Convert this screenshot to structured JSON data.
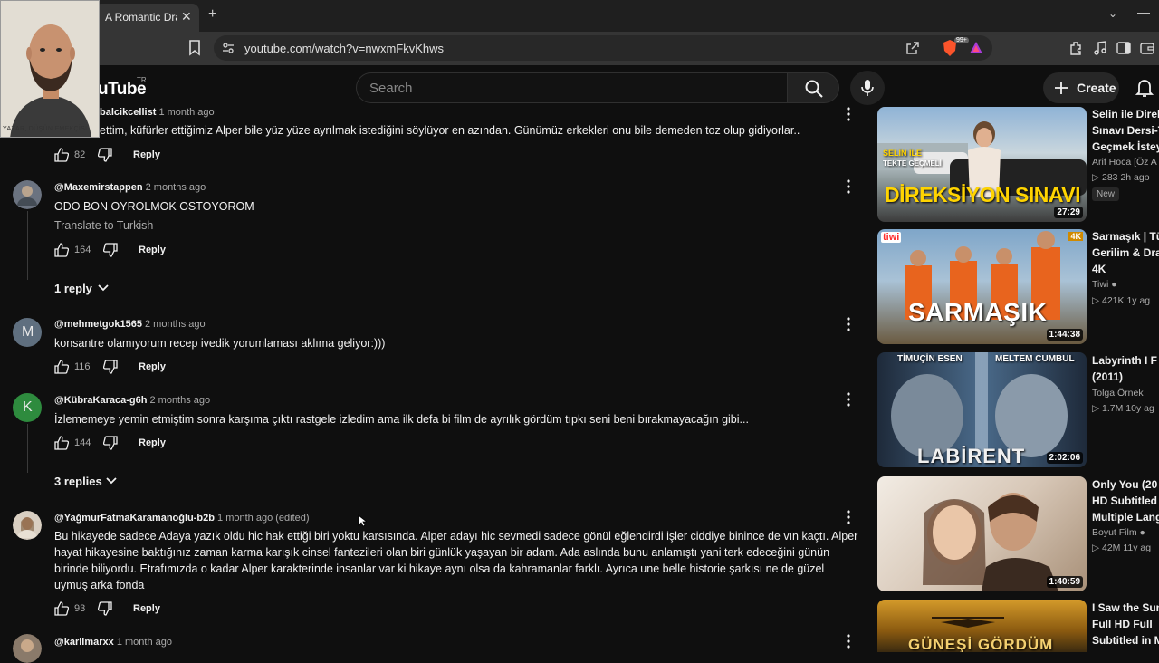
{
  "browser": {
    "tab_title": "A Romantic Dram",
    "url": "youtube.com/watch?v=nwxmFkvKhws",
    "brave_badge": "99+"
  },
  "webcam": {
    "caption": "YAZAR, DÜŞÜN EMEKÇİSİ"
  },
  "header": {
    "logo": "uTube",
    "region": "TR",
    "search_placeholder": "Search",
    "create_label": "Create"
  },
  "comments": [
    {
      "author": "balcikcellist",
      "time": "1 month ago",
      "text": "ettim, küfürler ettiğimiz Alper bile yüz yüze ayrılmak istediğini söylüyor en azından. Günümüz erkekleri onu bile demeden toz olup gidiyorlar..",
      "likes": "82",
      "reply_label": "Reply"
    },
    {
      "author": "@Maxemirstappen",
      "time": "2 months ago",
      "text": "ODO BON OYROLMOK OSTOYOROM",
      "translate": "Translate to Turkish",
      "likes": "164",
      "reply_label": "Reply",
      "replies": "1 reply"
    },
    {
      "author": "@mehmetgok1565",
      "time": "2 months ago",
      "avatar_letter": "M",
      "text": "konsantre olamıyorum recep ivedik yorumlaması aklıma geliyor:)))",
      "likes": "116",
      "reply_label": "Reply"
    },
    {
      "author": "@KübraKaraca-g6h",
      "time": "2 months ago",
      "avatar_letter": "K",
      "text": "İzlememeye yemin etmiştim sonra karşıma çıktı rastgele izledim ama ilk defa bi film de ayrılık gördüm tıpkı seni beni bırakmayacağın gibi...",
      "likes": "144",
      "reply_label": "Reply",
      "replies": "3 replies"
    },
    {
      "author": "@YağmurFatmaKaramanoğlu-b2b",
      "time": "1 month ago (edited)",
      "text": "Bu hikayede sadece Adaya yazık oldu hic hak ettiği biri yoktu karsısında. Alper adayı hic sevmedi sadece gönül eğlendirdi işler ciddiye binince de vın kaçtı. Alper hayat hikayesine baktığınız zaman karma karışık cinsel fantezileri olan biri günlük yaşayan bir adam. Ada aslında bunu anlamıştı yani terk edeceğini günün birinde biliyordu. Etrafımızda o kadar Alper karakterinde insanlar var ki hikaye aynı olsa da kahramanlar farklı. Ayrıca une belle historie şarkısı ne de güzel uymuş arka fonda",
      "likes": "93",
      "reply_label": "Reply"
    },
    {
      "author": "@karllmarxx",
      "time": "1 month ago"
    }
  ],
  "sidebar": [
    {
      "title_lines": [
        "Selin ile Direk",
        "Sınavı Dersi-T",
        "Geçmek İstey"
      ],
      "channel": "Arif Hoca [Öz A",
      "views": "283",
      "age": "2h ago",
      "badge": "New",
      "duration": "27:29",
      "thumb_top": "SELİN İLE",
      "thumb_top2": "TEKTE GEÇMELİ",
      "thumb_main": "DİREKSİYON SINAVI"
    },
    {
      "title_lines": [
        "Sarmaşık | Tü",
        "Gerilim & Dra",
        "4K"
      ],
      "channel": "Tiwi",
      "views": "421K",
      "age": "1y ag",
      "duration": "1:44:38",
      "thumb_main": "SARMAŞIK",
      "thumb_logo": "tiwi",
      "thumb_4k": "4K"
    },
    {
      "title_lines": [
        "Labyrinth I F",
        "(2011)"
      ],
      "channel": "Tolga Örnek",
      "views": "1.7M",
      "age": "10y ag",
      "duration": "2:02:06",
      "thumb_left": "TİMUÇİN ESEN",
      "thumb_right": "MELTEM CUMBUL",
      "thumb_main": "LABİRENT"
    },
    {
      "title_lines": [
        "Only You (20",
        "HD  Subtitled",
        "Multiple Lang"
      ],
      "channel": "Boyut Film",
      "views": "42M",
      "age": "11y ag",
      "duration": "1:40:59"
    },
    {
      "title_lines": [
        "I Saw the Sun",
        "Full HD Full",
        "Subtitled in M"
      ],
      "thumb_main": "GÜNEŞİ GÖRDÜM"
    }
  ],
  "colors": {
    "accent_red": "#ff0000",
    "avatar_m": "#5f6f7f",
    "avatar_k": "#2e8b3e",
    "tab_bg": "#353535"
  }
}
